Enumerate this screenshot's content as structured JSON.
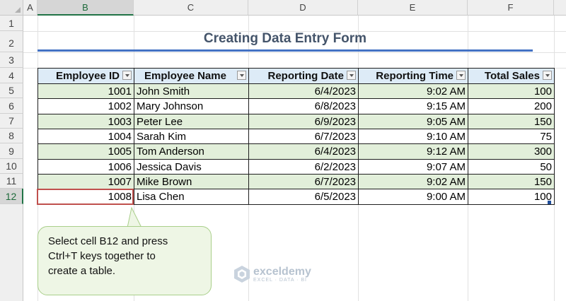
{
  "columns": [
    "A",
    "B",
    "C",
    "D",
    "E",
    "F"
  ],
  "selected_column": "B",
  "rows": [
    "1",
    "2",
    "3",
    "4",
    "5",
    "6",
    "7",
    "8",
    "9",
    "10",
    "11",
    "12"
  ],
  "selected_row": "12",
  "title": "Creating Data Entry Form",
  "table": {
    "headers": [
      "Employee ID",
      "Employee Name",
      "Reporting Date",
      "Reporting Time",
      "Total Sales"
    ],
    "rows": [
      [
        "1001",
        "John Smith",
        "6/4/2023",
        "9:02 AM",
        "100"
      ],
      [
        "1002",
        "Mary Johnson",
        "6/8/2023",
        "9:15 AM",
        "200"
      ],
      [
        "1003",
        "Peter Lee",
        "6/9/2023",
        "9:05 AM",
        "150"
      ],
      [
        "1004",
        "Sarah Kim",
        "6/7/2023",
        "9:10 AM",
        "75"
      ],
      [
        "1005",
        "Tom Anderson",
        "6/4/2023",
        "9:12 AM",
        "300"
      ],
      [
        "1006",
        "Jessica Davis",
        "6/2/2023",
        "9:07 AM",
        "50"
      ],
      [
        "1007",
        "Mike Brown",
        "6/7/2023",
        "9:02 AM",
        "150"
      ],
      [
        "1008",
        "Lisa Chen",
        "6/5/2023",
        "9:00 AM",
        "100"
      ]
    ]
  },
  "callout": {
    "lines": [
      "Select cell B12 and press",
      "Ctrl+T keys together to",
      "create a table."
    ]
  },
  "watermark": {
    "name": "exceldemy",
    "tagline": "EXCEL · DATA · BI"
  },
  "colors": {
    "title": "#44546a",
    "accent_rule": "#4472c4",
    "header_fill": "#ddebf7",
    "band_fill": "#e2efda",
    "active_border": "#c0504d",
    "callout_fill": "#eef6e5"
  }
}
